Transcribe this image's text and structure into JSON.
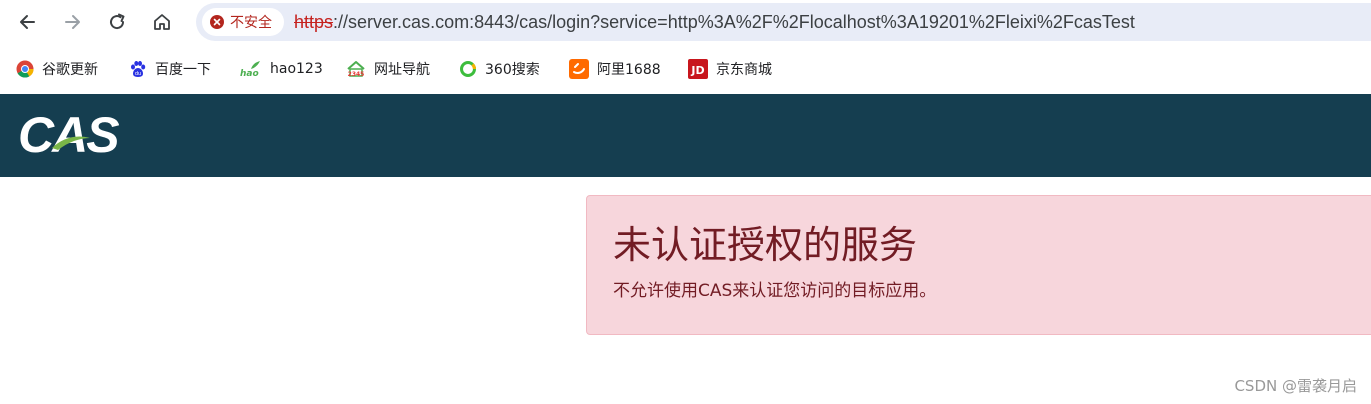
{
  "browser": {
    "nav": {
      "back_icon": "arrow-left-icon",
      "forward_icon": "arrow-right-icon",
      "reload_icon": "reload-icon",
      "home_icon": "home-icon"
    },
    "security_label": "不安全",
    "url_scheme": "https",
    "url_rest": "://server.cas.com:8443/cas/login?service=http%3A%2F%2Flocalhost%3A19201%2Fleixi%2FcasTest"
  },
  "bookmarks": [
    {
      "label": "谷歌更新",
      "icon": "chrome-icon"
    },
    {
      "label": "百度一下",
      "icon": "baidu-paw-icon"
    },
    {
      "label": "hao123",
      "icon": "hao123-icon"
    },
    {
      "label": "网址导航",
      "icon": "2345-house-icon"
    },
    {
      "label": "360搜索",
      "icon": "360-search-icon"
    },
    {
      "label": "阿里1688",
      "icon": "alibaba-1688-icon"
    },
    {
      "label": "京东商城",
      "icon": "jd-icon"
    }
  ],
  "cas": {
    "logo_text": "CAS"
  },
  "alert": {
    "title": "未认证授权的服务",
    "message": "不允许使用CAS来认证您访问的目标应用。"
  },
  "watermark": "CSDN @雷袭月启",
  "colors": {
    "header_bg": "#153e50",
    "alert_bg": "#f7d6dc",
    "alert_text": "#721c24",
    "insecure_red": "#c5221f"
  }
}
